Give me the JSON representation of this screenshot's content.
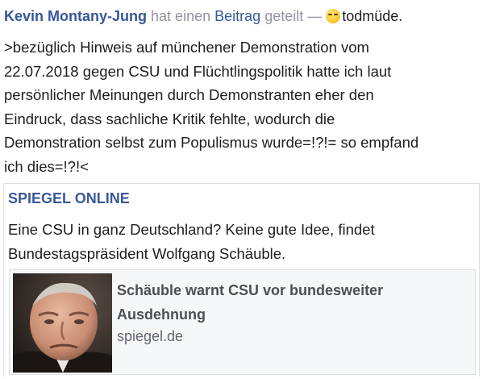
{
  "post": {
    "author": "Kevin Montany-Jung",
    "action_prefix": "hat einen",
    "action_link": "Beitrag",
    "action_suffix": "geteilt —",
    "feeling_icon": "sleepy-face-emoji",
    "feeling": "todmüde.",
    "body": ">bezüglich Hinweis auf münchener Demonstration vom\n22.07.2018 gegen CSU und Flüchtlingspolitik hatte ich laut\npersönlicher Meinungen durch Demonstranten eher den\nEindruck, dass sachliche Kritik fehlte, wodurch die\nDemonstration selbst zum Populismus wurde=!?!= so empfand\nich dies=!?!<"
  },
  "shared": {
    "source": "SPIEGEL ONLINE",
    "summary": "Eine CSU in ganz Deutschland? Keine gute Idee, findet Bundestagspräsident Wolfgang Schäuble.",
    "link": {
      "title": "Schäuble warnt CSU vor bundesweiter Ausdehnung",
      "domain": "spiegel.de",
      "thumbnail": "portrait-photo"
    }
  },
  "colors": {
    "link_blue": "#365899",
    "source_blue": "#3b5998",
    "meta_gray": "#90949c",
    "text": "#1c1e21",
    "card_bg": "#f6f7f9"
  }
}
